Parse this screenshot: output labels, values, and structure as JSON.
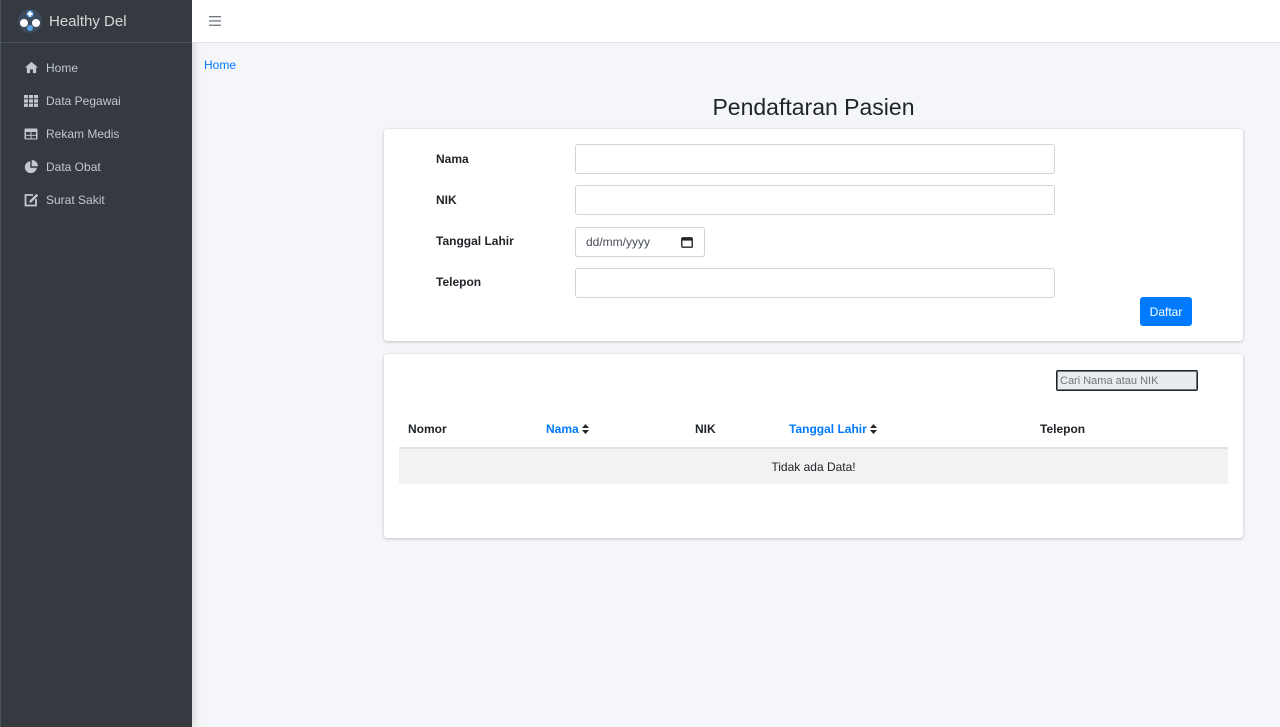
{
  "app": {
    "brand": "Healthy Del"
  },
  "sidebar": {
    "items": [
      {
        "label": "Home",
        "icon": "home-icon"
      },
      {
        "label": "Data Pegawai",
        "icon": "grid-icon"
      },
      {
        "label": "Rekam Medis",
        "icon": "table-icon"
      },
      {
        "label": "Data Obat",
        "icon": "pie-chart-icon"
      },
      {
        "label": "Surat Sakit",
        "icon": "edit-icon"
      }
    ]
  },
  "breadcrumb": {
    "home": "Home"
  },
  "page": {
    "title": "Pendaftaran Pasien"
  },
  "form": {
    "nama_label": "Nama",
    "nik_label": "NIK",
    "tanggal_label": "Tanggal Lahir",
    "tanggal_placeholder": "dd/mm/yyyy",
    "telepon_label": "Telepon",
    "submit_label": "Daftar"
  },
  "table": {
    "search_placeholder": "Cari Nama atau NIK",
    "headers": [
      "Nomor",
      "Nama",
      "NIK",
      "Tanggal Lahir",
      "Telepon"
    ],
    "empty_text": "Tidak ada Data!"
  },
  "colors": {
    "accent": "#007bff",
    "sidebar": "#343a40"
  }
}
